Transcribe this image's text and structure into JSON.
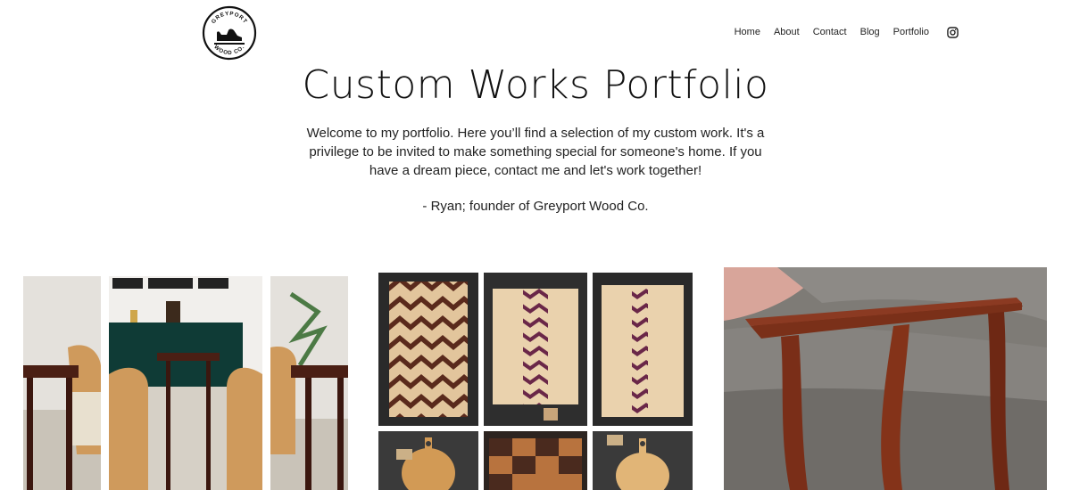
{
  "header": {
    "logo": {
      "top_text": "GREYPORT",
      "bottom_text": "WOOD CO."
    },
    "nav": [
      {
        "label": "Home"
      },
      {
        "label": "About"
      },
      {
        "label": "Contact"
      },
      {
        "label": "Blog"
      },
      {
        "label": "Portfolio"
      }
    ],
    "social_icon": "instagram-icon"
  },
  "main": {
    "title": "Custom Works Portfolio",
    "intro": "Welcome to my portfolio. Here you’ll find a selection of my custom work. It's a privilege to be invited to make something special for someone's home. If you have a dream piece, contact me and let's work together!",
    "signature": "- Ryan; founder of Greyport Wood Co."
  },
  "gallery": {
    "items": [
      {
        "subject": "end tables beside armchair"
      },
      {
        "subject": "cutting boards with chevron pattern"
      },
      {
        "subject": "serving boards"
      },
      {
        "subject": "end table over sofa"
      }
    ]
  },
  "colors": {
    "text": "#111111",
    "background": "#ffffff",
    "wood_dark": "#5a2418",
    "wood_light": "#d8b890",
    "wood_cherry": "#8b3a22"
  }
}
